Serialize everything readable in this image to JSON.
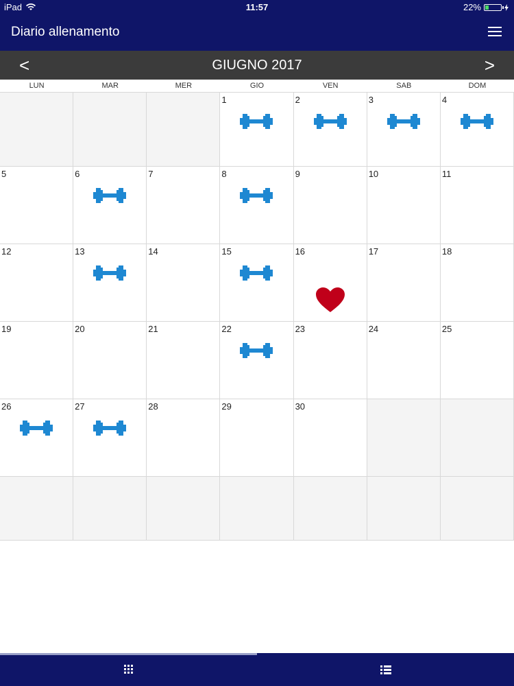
{
  "status_bar": {
    "device": "iPad",
    "time": "11:57",
    "battery": "22%",
    "battery_level": 0.22
  },
  "header": {
    "title": "Diario allenamento",
    "menu_icon": "hamburger-menu-icon"
  },
  "calendar": {
    "month_label": "GIUGNO 2017",
    "prev_label": "<",
    "next_label": ">",
    "weekdays": [
      "LUN",
      "MAR",
      "MER",
      "GIO",
      "VEN",
      "SAB",
      "DOM"
    ],
    "weeks": [
      [
        {
          "day": ""
        },
        {
          "day": ""
        },
        {
          "day": ""
        },
        {
          "day": "1",
          "icon": "dumbbell"
        },
        {
          "day": "2",
          "icon": "dumbbell"
        },
        {
          "day": "3",
          "icon": "dumbbell"
        },
        {
          "day": "4",
          "icon": "dumbbell"
        }
      ],
      [
        {
          "day": "5"
        },
        {
          "day": "6",
          "icon": "dumbbell"
        },
        {
          "day": "7"
        },
        {
          "day": "8",
          "icon": "dumbbell"
        },
        {
          "day": "9"
        },
        {
          "day": "10"
        },
        {
          "day": "11"
        }
      ],
      [
        {
          "day": "12"
        },
        {
          "day": "13",
          "icon": "dumbbell"
        },
        {
          "day": "14"
        },
        {
          "day": "15",
          "icon": "dumbbell"
        },
        {
          "day": "16",
          "icon": "heart"
        },
        {
          "day": "17"
        },
        {
          "day": "18"
        }
      ],
      [
        {
          "day": "19"
        },
        {
          "day": "20"
        },
        {
          "day": "21"
        },
        {
          "day": "22",
          "icon": "dumbbell"
        },
        {
          "day": "23"
        },
        {
          "day": "24"
        },
        {
          "day": "25"
        }
      ],
      [
        {
          "day": "26",
          "icon": "dumbbell"
        },
        {
          "day": "27",
          "icon": "dumbbell"
        },
        {
          "day": "28"
        },
        {
          "day": "29"
        },
        {
          "day": "30"
        },
        {
          "day": ""
        },
        {
          "day": ""
        }
      ],
      [
        {
          "day": ""
        },
        {
          "day": ""
        },
        {
          "day": ""
        },
        {
          "day": ""
        },
        {
          "day": ""
        },
        {
          "day": ""
        },
        {
          "day": ""
        }
      ]
    ]
  },
  "tabs": [
    {
      "icon": "grid-icon",
      "active": true
    },
    {
      "icon": "list-icon",
      "active": false
    }
  ],
  "colors": {
    "primary": "#0f1568",
    "month_bar": "#3b3b3b",
    "dumbbell": "#1e88d2",
    "heart": "#c0001a"
  }
}
